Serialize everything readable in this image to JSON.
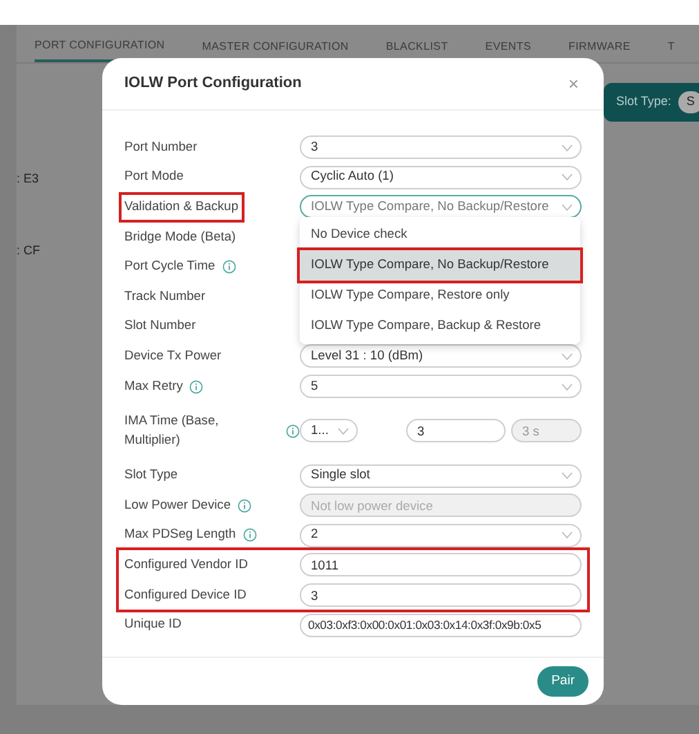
{
  "tabs": [
    {
      "label": "PORT CONFIGURATION",
      "selected": true
    },
    {
      "label": "MASTER CONFIGURATION",
      "selected": false
    },
    {
      "label": "BLACKLIST",
      "selected": false
    },
    {
      "label": "EVENTS",
      "selected": false
    },
    {
      "label": "FIRMWARE",
      "selected": false
    },
    {
      "label": "T",
      "selected": false
    }
  ],
  "toolbar": {
    "label": "Slot Type:",
    "chip": "S"
  },
  "background_rows": [
    ": E3",
    ": CF"
  ],
  "modal": {
    "title": "IOLW Port Configuration",
    "close": "×",
    "rows": [
      {
        "label": "Port Number",
        "kind": "select",
        "value": "3"
      },
      {
        "label": "Port Mode",
        "kind": "select",
        "value": "Cyclic Auto (1)"
      },
      {
        "label": "Validation & Backup",
        "kind": "select",
        "value": "IOLW Type Compare, No Backup/Restore",
        "focused": true,
        "label_outlined": true
      },
      {
        "label": "Bridge Mode (Beta)",
        "kind": "covered"
      },
      {
        "label": "Port Cycle Time",
        "kind": "covered",
        "info": true
      },
      {
        "label": "Track Number",
        "kind": "covered"
      },
      {
        "label": "Slot Number",
        "kind": "covered"
      },
      {
        "label": "Device Tx Power",
        "kind": "select",
        "value": "Level 31 : 10 (dBm)"
      },
      {
        "label": "Max Retry",
        "kind": "select",
        "value": "5",
        "info": true
      },
      {
        "label": "IMA Time (Base, Multiplier)",
        "kind": "ima",
        "info": true,
        "base": "1...",
        "multiplier": "3",
        "result": "3 s"
      },
      {
        "label": "Slot Type",
        "kind": "select",
        "value": "Single slot"
      },
      {
        "label": "Low Power Device",
        "kind": "disabled",
        "info": true,
        "placeholder": "Not low power device"
      },
      {
        "label": "Max PDSeg Length",
        "kind": "select",
        "value": "2",
        "info": true
      },
      {
        "label": "Configured Vendor ID",
        "kind": "input",
        "value": "1011",
        "outlined": true
      },
      {
        "label": "Configured Device ID",
        "kind": "input",
        "value": "3",
        "outlined": true
      },
      {
        "label": "Unique ID",
        "kind": "input",
        "value": "0x03:0xf3:0x00:0x01:0x03:0x14:0x3f:0x9b:0x5"
      }
    ],
    "dropdown": [
      {
        "label": "No Device check",
        "selected": false,
        "outlined": false
      },
      {
        "label": "IOLW Type Compare, No Backup/Restore",
        "selected": true,
        "outlined": true
      },
      {
        "label": "IOLW Type Compare, Restore only",
        "selected": false,
        "outlined": false
      },
      {
        "label": "IOLW Type Compare, Backup & Restore",
        "selected": false,
        "outlined": false
      }
    ],
    "submit": "Pair"
  }
}
